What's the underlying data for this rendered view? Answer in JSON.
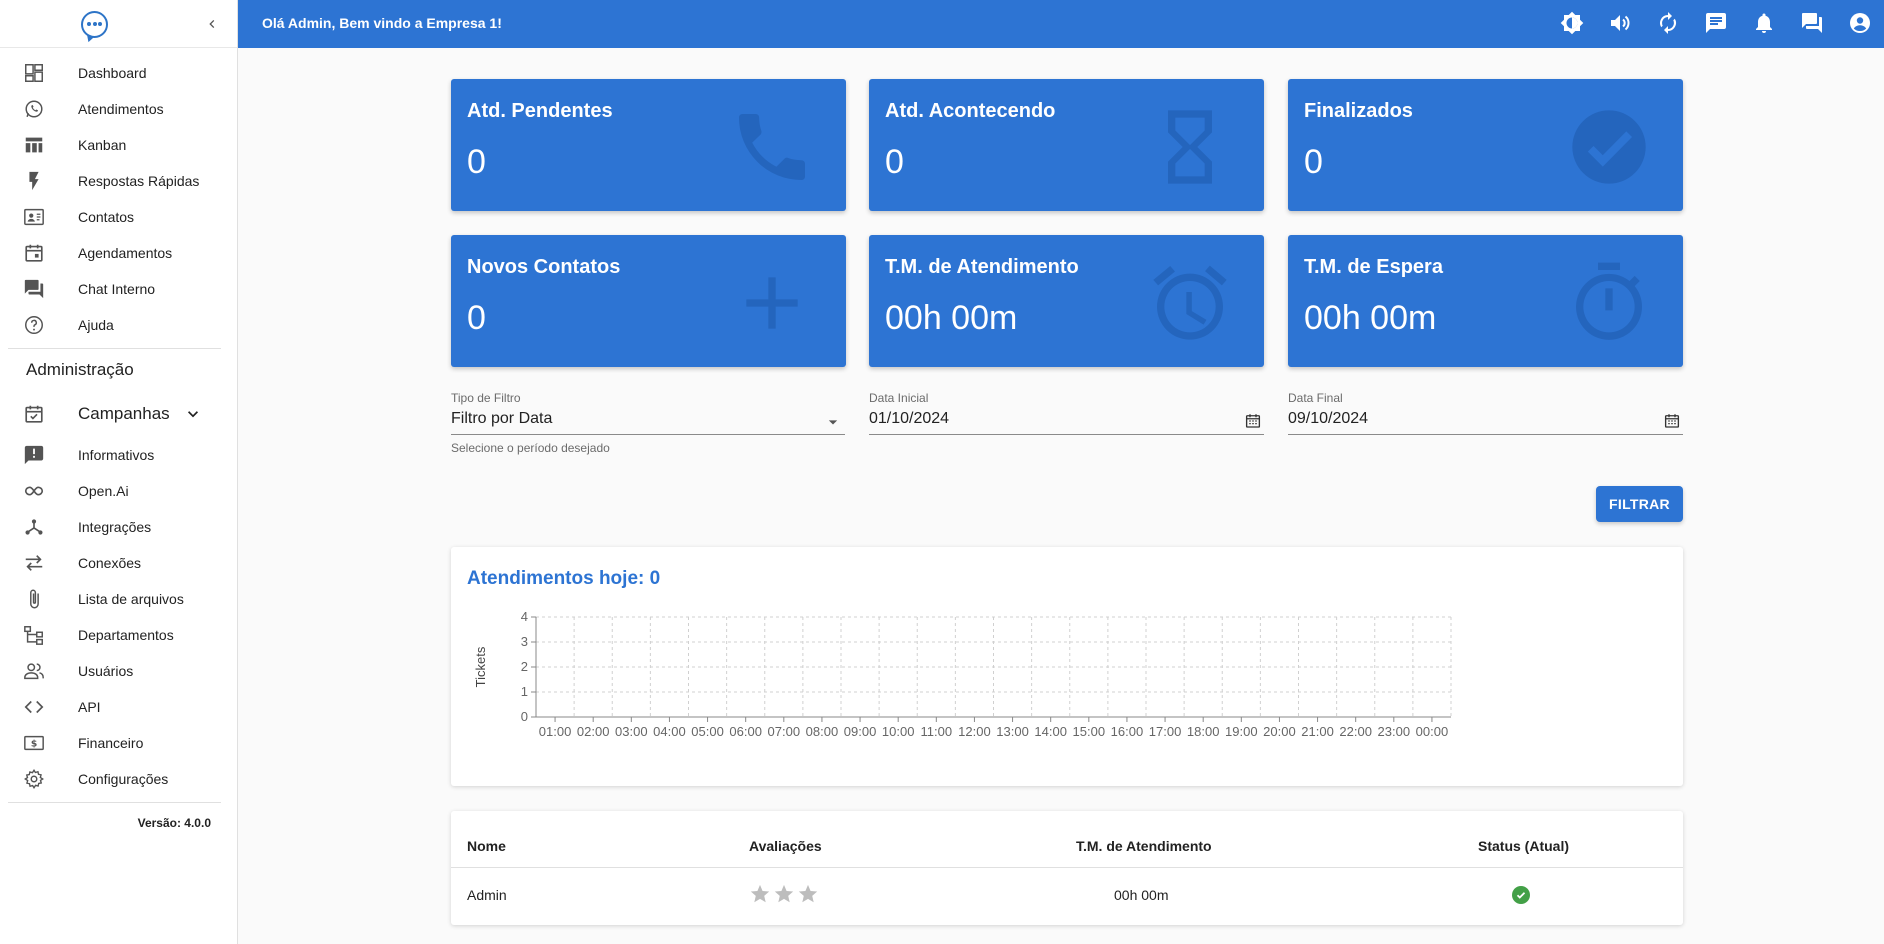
{
  "sidebar": {
    "nav": [
      {
        "label": "Dashboard",
        "icon": "dashboard-icon"
      },
      {
        "label": "Atendimentos",
        "icon": "whatsapp-icon"
      },
      {
        "label": "Kanban",
        "icon": "kanban-icon"
      },
      {
        "label": "Respostas Rápidas",
        "icon": "flash-icon"
      },
      {
        "label": "Contatos",
        "icon": "contact-card-icon"
      },
      {
        "label": "Agendamentos",
        "icon": "calendar-icon"
      },
      {
        "label": "Chat Interno",
        "icon": "chat-icon"
      },
      {
        "label": "Ajuda",
        "icon": "help-icon"
      }
    ],
    "admin_title": "Administração",
    "campaigns_label": "Campanhas",
    "admin_nav": [
      {
        "label": "Informativos",
        "icon": "announcement-icon"
      },
      {
        "label": "Open.Ai",
        "icon": "infinity-icon"
      },
      {
        "label": "Integrações",
        "icon": "hub-icon"
      },
      {
        "label": "Conexões",
        "icon": "sync-arrows-icon"
      },
      {
        "label": "Lista de arquivos",
        "icon": "attach-icon"
      },
      {
        "label": "Departamentos",
        "icon": "departments-icon"
      },
      {
        "label": "Usuários",
        "icon": "users-icon"
      },
      {
        "label": "API",
        "icon": "code-icon"
      },
      {
        "label": "Financeiro",
        "icon": "money-icon"
      },
      {
        "label": "Configurações",
        "icon": "gear-icon"
      }
    ],
    "version": "Versão: 4.0.0"
  },
  "topbar": {
    "greeting": "Olá Admin, Bem vindo a Empresa 1!"
  },
  "cards": [
    {
      "title": "Atd. Pendentes",
      "value": "0",
      "icon": "phone-icon"
    },
    {
      "title": "Atd. Acontecendo",
      "value": "0",
      "icon": "hourglass-icon"
    },
    {
      "title": "Finalizados",
      "value": "0",
      "icon": "check-circle-icon"
    },
    {
      "title": "Novos Contatos",
      "value": "0",
      "icon": "plus-icon"
    },
    {
      "title": "T.M. de Atendimento",
      "value": "00h 00m",
      "icon": "alarm-icon"
    },
    {
      "title": "T.M. de Espera",
      "value": "00h 00m",
      "icon": "timer-icon"
    }
  ],
  "filters": {
    "type_label": "Tipo de Filtro",
    "type_value": "Filtro por Data",
    "type_help": "Selecione o período desejado",
    "start_label": "Data Inicial",
    "start_value": "01/10/2024",
    "end_label": "Data Final",
    "end_value": "09/10/2024",
    "submit_label": "FILTRAR"
  },
  "chart_panel": {
    "title": "Atendimentos hoje: 0"
  },
  "chart_data": {
    "type": "bar",
    "title": "Atendimentos hoje: 0",
    "xlabel": "",
    "ylabel": "Tickets",
    "categories": [
      "01:00",
      "02:00",
      "03:00",
      "04:00",
      "05:00",
      "06:00",
      "07:00",
      "08:00",
      "09:00",
      "10:00",
      "11:00",
      "12:00",
      "13:00",
      "14:00",
      "15:00",
      "16:00",
      "17:00",
      "18:00",
      "19:00",
      "20:00",
      "21:00",
      "22:00",
      "23:00",
      "00:00"
    ],
    "values": [
      0,
      0,
      0,
      0,
      0,
      0,
      0,
      0,
      0,
      0,
      0,
      0,
      0,
      0,
      0,
      0,
      0,
      0,
      0,
      0,
      0,
      0,
      0,
      0
    ],
    "ylim": [
      0,
      4
    ],
    "yticks": [
      0,
      1,
      2,
      3,
      4
    ],
    "grid": true,
    "colors": {
      "bar": "#2d74d3",
      "grid": "#d0d0d0",
      "axis": "#888888",
      "tick": "#666666"
    }
  },
  "table": {
    "headers": {
      "name": "Nome",
      "ratings": "Avaliações",
      "avg_time": "T.M. de Atendimento",
      "status": "Status (Atual)"
    },
    "rows": [
      {
        "name": "Admin",
        "avg_time": "00h 00m",
        "stars": 3,
        "status": "online"
      }
    ]
  },
  "colors": {
    "primary": "#2d74d3",
    "success": "#43a047"
  }
}
